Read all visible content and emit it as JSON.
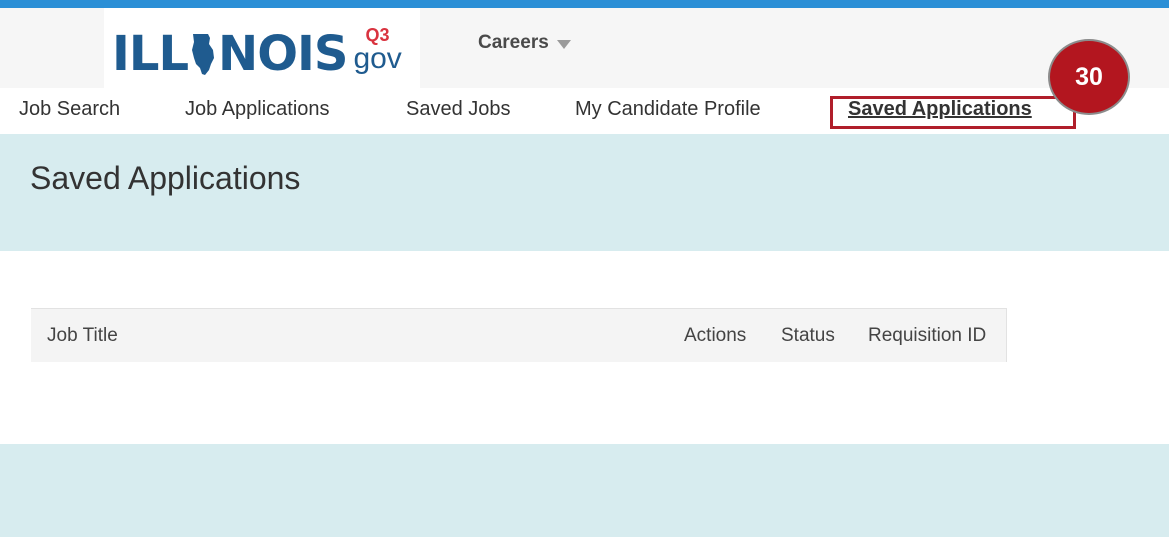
{
  "header": {
    "logo": {
      "wordmark_left": "ILL",
      "wordmark_right": "NOIS",
      "badge": "Q3",
      "suffix": "gov"
    },
    "careers_menu_label": "Careers"
  },
  "nav": {
    "items": [
      {
        "label": "Job Search"
      },
      {
        "label": "Job Applications"
      },
      {
        "label": "Saved Jobs"
      },
      {
        "label": "My Candidate Profile"
      },
      {
        "label": "Saved Applications",
        "active": true
      }
    ]
  },
  "annotation": {
    "step_number": "30",
    "badge_color": "#b3161f"
  },
  "main": {
    "title": "Saved Applications",
    "table": {
      "columns": [
        "Job Title",
        "Actions",
        "Status",
        "Requisition ID"
      ],
      "rows": []
    }
  },
  "colors": {
    "accent_blue": "#2b8fd6",
    "logo_blue": "#1f5b8f",
    "logo_red": "#d9333f",
    "band": "#d7ecef",
    "highlight": "#b01e2a"
  }
}
